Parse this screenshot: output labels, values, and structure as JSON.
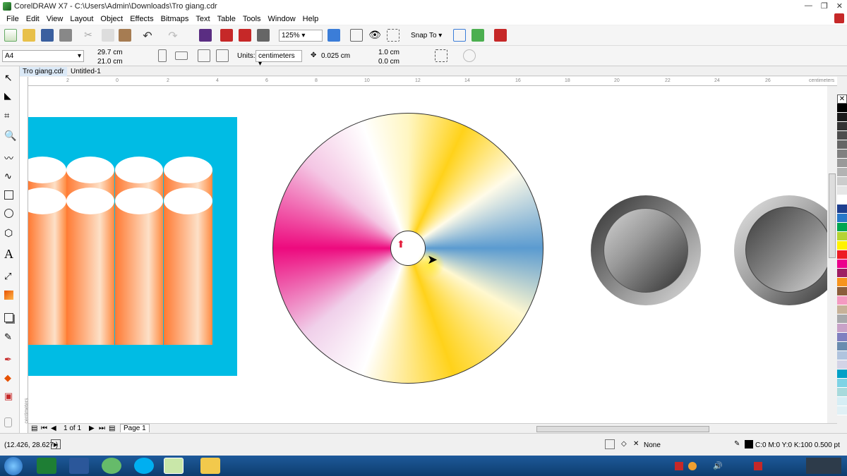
{
  "window": {
    "title": "CorelDRAW X7 - C:\\Users\\Admin\\Downloads\\Tro giang.cdr",
    "controls": [
      "—",
      "❐",
      "✕"
    ]
  },
  "menu": [
    "File",
    "Edit",
    "View",
    "Layout",
    "Object",
    "Effects",
    "Bitmaps",
    "Text",
    "Table",
    "Tools",
    "Window",
    "Help"
  ],
  "toolbar": {
    "zoom": "125%",
    "snap_label": "Snap To"
  },
  "property_bar": {
    "page_size": "A4",
    "width": "29.7 cm",
    "height": "21.0 cm",
    "units_label": "Units:",
    "units_value": "centimeters",
    "nudge": "0.025 cm",
    "dup_x": "1.0 cm",
    "dup_y": "0.0 cm"
  },
  "tabs": [
    {
      "label": "Tro giang.cdr",
      "active": true
    },
    {
      "label": "Untitled-1",
      "active": false
    }
  ],
  "ruler": {
    "ticks": [
      "2",
      "0",
      "2",
      "4",
      "6",
      "8",
      "10",
      "12",
      "14",
      "16",
      "18",
      "20",
      "22",
      "24",
      "26"
    ],
    "unit": "centimeters",
    "v_unit": "centimeters"
  },
  "page_nav": {
    "counter": "1 of 1",
    "page_tab": "Page 1"
  },
  "status": {
    "coords": "(12.426, 28.627 )",
    "fill": "None",
    "outline": "C:0 M:0 Y:0 K:100  0.500 pt"
  },
  "palette_colors": [
    "#000000",
    "#1a1a1a",
    "#333333",
    "#4d4d4d",
    "#666666",
    "#808080",
    "#999999",
    "#b3b3b3",
    "#cccccc",
    "#e6e6e6",
    "#ffffff",
    "#1e3f8f",
    "#2979c9",
    "#00a651",
    "#b5d334",
    "#fff200",
    "#ed1c24",
    "#ec008c",
    "#9e1f63",
    "#f7941d",
    "#8b5e3c",
    "#f49ac1",
    "#c7b299",
    "#a7a9ac",
    "#c8a2c8",
    "#8080c0",
    "#6a8caf",
    "#b0c4de",
    "#d3d3e6",
    "#00a0c6",
    "#7fd3e5",
    "#a8dadc",
    "#d6eef5",
    "#e0f0f5"
  ]
}
